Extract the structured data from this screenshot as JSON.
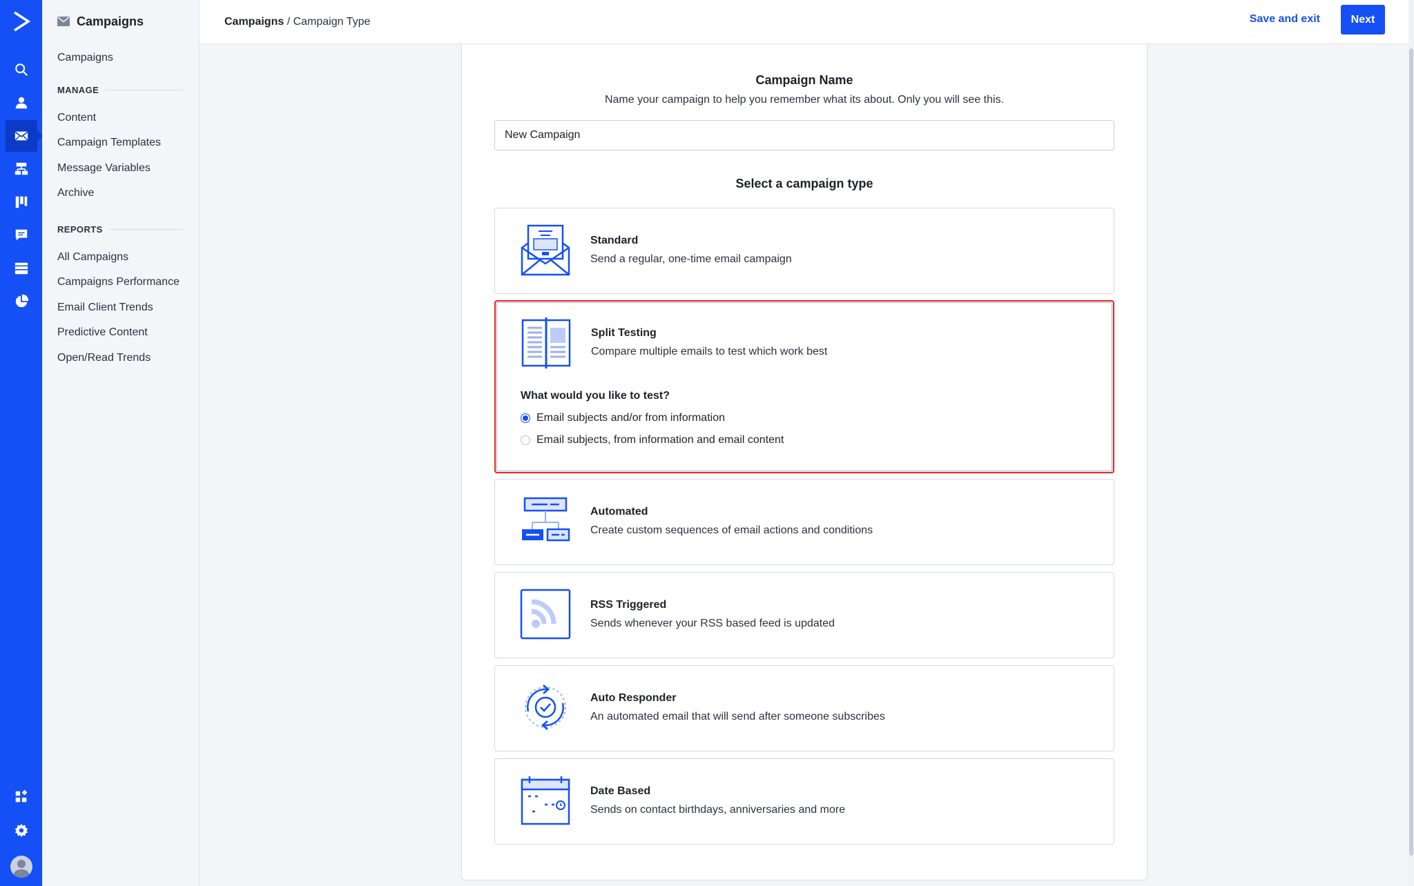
{
  "sidebar": {
    "header": "Campaigns",
    "top_link": "Campaigns",
    "manage_label": "MANAGE",
    "manage_items": [
      "Content",
      "Campaign Templates",
      "Message Variables",
      "Archive"
    ],
    "reports_label": "REPORTS",
    "report_items": [
      "All Campaigns",
      "Campaigns Performance",
      "Email Client Trends",
      "Predictive Content",
      "Open/Read Trends"
    ]
  },
  "rail": {
    "icons": [
      "search-icon",
      "contacts-icon",
      "campaigns-icon",
      "automations-icon",
      "deals-icon",
      "conversations-icon",
      "site-icon",
      "reports-icon"
    ],
    "active": "campaigns-icon",
    "bottom_icons": [
      "apps-icon",
      "settings-icon",
      "avatar"
    ]
  },
  "topbar": {
    "breadcrumb_root": "Campaigns",
    "breadcrumb_separator": " / ",
    "breadcrumb_current": "Campaign Type",
    "save_exit": "Save and exit",
    "next": "Next"
  },
  "form": {
    "name_title": "Campaign Name",
    "name_subtitle": "Name your campaign to help you remember what its about. Only you will see this.",
    "name_value": "New Campaign",
    "type_title": "Select a campaign type"
  },
  "types": [
    {
      "title": "Standard",
      "desc": "Send a regular, one-time email campaign",
      "icon": "envelope-icon"
    },
    {
      "title": "Split Testing",
      "desc": "Compare multiple emails to test which work best",
      "icon": "split-test-icon",
      "selected": true
    },
    {
      "title": "Automated",
      "desc": "Create custom sequences of email actions and conditions",
      "icon": "flowchart-icon"
    },
    {
      "title": "RSS Triggered",
      "desc": "Sends whenever your RSS based feed is updated",
      "icon": "rss-icon"
    },
    {
      "title": "Auto Responder",
      "desc": "An automated email that will send after someone subscribes",
      "icon": "auto-responder-icon"
    },
    {
      "title": "Date Based",
      "desc": "Sends on contact birthdays, anniversaries and more",
      "icon": "calendar-icon"
    }
  ],
  "split_test": {
    "question": "What would you like to test?",
    "options": [
      "Email subjects and/or from information",
      "Email subjects, from information and email content"
    ],
    "selected_option": 0
  },
  "colors": {
    "brand_blue": "#1450f5",
    "highlight_red": "#e0261d"
  }
}
